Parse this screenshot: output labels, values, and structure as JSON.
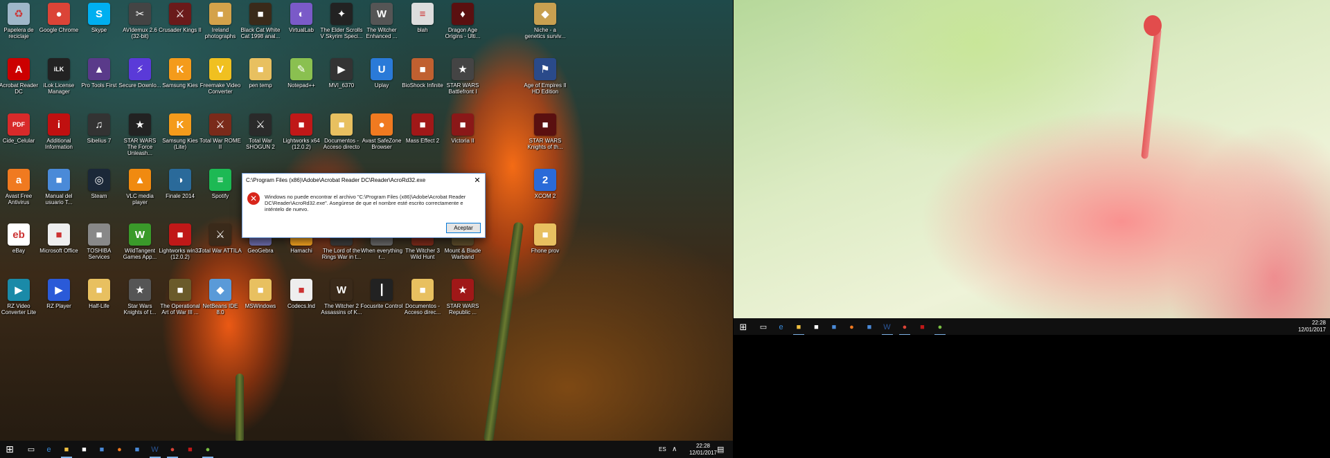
{
  "monitor1": {
    "icons": [
      {
        "label": "Papelera de reciclaje",
        "glyph": "♻",
        "color": "#9fb7c9"
      },
      {
        "label": "Google Chrome",
        "glyph": "●",
        "color": "#db4437"
      },
      {
        "label": "Skype",
        "glyph": "S",
        "color": "#00aff0"
      },
      {
        "label": "AVIdemux 2.6 (32-bit)",
        "glyph": "✂",
        "color": "#444"
      },
      {
        "label": "Crusader Kings II",
        "glyph": "⚔",
        "color": "#6a1a1a"
      },
      {
        "label": "Ireland photographs",
        "glyph": "■",
        "color": "#d4a24a"
      },
      {
        "label": "Black Cat White Cat 1998 anal...",
        "glyph": "■",
        "color": "#3a2a1a"
      },
      {
        "label": "VirtualLab",
        "glyph": "◐",
        "color": "#7a5ac8"
      },
      {
        "label": "The Elder Scrolls V Skyrim Speci...",
        "glyph": "✦",
        "color": "#222"
      },
      {
        "label": "The Witcher Enhanced ...",
        "glyph": "W",
        "color": "#555"
      },
      {
        "label": "blah",
        "glyph": "≡",
        "color": "#ddd"
      },
      {
        "label": "Dragon Age Origins - Ulti...",
        "glyph": "♦",
        "color": "#5a1010"
      },
      {
        "label": "Niche - a genetics surviv...",
        "glyph": "◆",
        "color": "#c8a050"
      },
      {
        "label": "Acrobat Reader DC",
        "glyph": "A",
        "color": "#c00"
      },
      {
        "label": "iLok License Manager",
        "glyph": "iLK",
        "color": "#222"
      },
      {
        "label": "Pro Tools First",
        "glyph": "▲",
        "color": "#5a3a8a"
      },
      {
        "label": "Secure Downlo...",
        "glyph": "⚡",
        "color": "#5a3ad8"
      },
      {
        "label": "Samsung Kies",
        "glyph": "K",
        "color": "#f49b1b"
      },
      {
        "label": "Freemake Video Converter",
        "glyph": "V",
        "color": "#f0c020"
      },
      {
        "label": "pen temp",
        "glyph": "■",
        "color": "#e8c060"
      },
      {
        "label": "Notepad++",
        "glyph": "✎",
        "color": "#8ac050"
      },
      {
        "label": "MVI_6370",
        "glyph": "▶",
        "color": "#333"
      },
      {
        "label": "Uplay",
        "glyph": "U",
        "color": "#2a7ad8"
      },
      {
        "label": "BioShock Infinite",
        "glyph": "■",
        "color": "#c06030"
      },
      {
        "label": "STAR WARS Battlefront I",
        "glyph": "★",
        "color": "#444"
      },
      {
        "label": "Age of Empires II HD Edition",
        "glyph": "⚑",
        "color": "#2a4a8a"
      },
      {
        "label": "Cide_Celular",
        "glyph": "PDF",
        "color": "#d82a2a"
      },
      {
        "label": "Additional Information",
        "glyph": "i",
        "color": "#c01010"
      },
      {
        "label": "Sibelius 7",
        "glyph": "♫",
        "color": "#333"
      },
      {
        "label": "STAR WARS The Force Unleash...",
        "glyph": "★",
        "color": "#222"
      },
      {
        "label": "Samsung Kies (Lite)",
        "glyph": "K",
        "color": "#f49b1b"
      },
      {
        "label": "Total War ROME II",
        "glyph": "⚔",
        "color": "#7a2a1a"
      },
      {
        "label": "Total War SHOGUN 2",
        "glyph": "⚔",
        "color": "#2a2a2a"
      },
      {
        "label": "Lightworks x64 (12.0.2)",
        "glyph": "■",
        "color": "#c01818"
      },
      {
        "label": "Documentos - Acceso directo",
        "glyph": "■",
        "color": "#e8c060"
      },
      {
        "label": "Avast SafeZone Browser",
        "glyph": "●",
        "color": "#f07a20"
      },
      {
        "label": "Mass Effect 2",
        "glyph": "■",
        "color": "#a01818"
      },
      {
        "label": "Victoria II",
        "glyph": "■",
        "color": "#8a1818"
      },
      {
        "label": "STAR WARS Knights of th...",
        "glyph": "■",
        "color": "#5a1010"
      },
      {
        "label": "Avast Free Antivirus",
        "glyph": "a",
        "color": "#f07a20"
      },
      {
        "label": "Manual del usuario T...",
        "glyph": "■",
        "color": "#4a8ad8"
      },
      {
        "label": "Steam",
        "glyph": "◎",
        "color": "#1b2838"
      },
      {
        "label": "VLC media player",
        "glyph": "▲",
        "color": "#f08a10"
      },
      {
        "label": "Finale 2014",
        "glyph": "◑",
        "color": "#2a6a9a"
      },
      {
        "label": "Spotify",
        "glyph": "≡",
        "color": "#1db954"
      },
      {
        "label": "XCOM 2",
        "glyph": "2",
        "color": "#2a6ad8"
      },
      {
        "label": "eBay",
        "glyph": "eb",
        "color": "#fff"
      },
      {
        "label": "Microsoft Office",
        "glyph": "■",
        "color": "#eee"
      },
      {
        "label": "TOSHIBA Services",
        "glyph": "■",
        "color": "#888"
      },
      {
        "label": "WildTangent Games App...",
        "glyph": "W",
        "color": "#3a9a2a"
      },
      {
        "label": "Lightworks win32 (12.0.2)",
        "glyph": "■",
        "color": "#c01818"
      },
      {
        "label": "Total War ATTILA",
        "glyph": "⚔",
        "color": "#3a2a1a"
      },
      {
        "label": "GeoGebra",
        "glyph": "○",
        "color": "#6a6aa8"
      },
      {
        "label": "Hamachi",
        "glyph": "●",
        "color": "#f0a020"
      },
      {
        "label": "The Lord of the Rings War in t...",
        "glyph": "■",
        "color": "#3a3a3a"
      },
      {
        "label": "When everything r...",
        "glyph": "■",
        "color": "#666"
      },
      {
        "label": "The Witcher 3 Wild Hunt",
        "glyph": "W",
        "color": "#7a2a1a"
      },
      {
        "label": "Mount & Blade Warband",
        "glyph": "⚔",
        "color": "#5a4a2a"
      },
      {
        "label": "Fhone prov",
        "glyph": "■",
        "color": "#e8c060"
      },
      {
        "label": "RZ Video Converter Lite",
        "glyph": "▶",
        "color": "#1a8aa8"
      },
      {
        "label": "RZ Player",
        "glyph": "▶",
        "color": "#2a5ad8"
      },
      {
        "label": "Half-Life",
        "glyph": "■",
        "color": "#e8c060"
      },
      {
        "label": "Star Wars Knights of t...",
        "glyph": "★",
        "color": "#555"
      },
      {
        "label": "The Operational Art of War III ...",
        "glyph": "■",
        "color": "#6a5a2a"
      },
      {
        "label": "NetBeans IDE 8.0",
        "glyph": "◆",
        "color": "#5a9ad8"
      },
      {
        "label": "MSWindows",
        "glyph": "■",
        "color": "#e8c060"
      },
      {
        "label": "Codecs.lnd",
        "glyph": "■",
        "color": "#eee"
      },
      {
        "label": "The Witcher 2 Assassins of K...",
        "glyph": "W",
        "color": "#3a2a1a"
      },
      {
        "label": "Focusrite Control",
        "glyph": "┃",
        "color": "#222"
      },
      {
        "label": "Documentos - Acceso direc...",
        "glyph": "■",
        "color": "#e8c060"
      },
      {
        "label": "STAR WARS Republic ...",
        "glyph": "★",
        "color": "#a01818"
      }
    ],
    "dialog": {
      "title": "C:\\Program Files (x86)\\Adobe\\Acrobat Reader DC\\Reader\\AcroRd32.exe",
      "close_glyph": "✕",
      "error_glyph": "✕",
      "message": "Windows no puede encontrar el archivo \"C:\\Program Files (x86)\\Adobe\\Acrobat Reader DC\\Reader\\AcroRd32.exe\". Asegúrese de que el nombre esté escrito correctamente e inténtelo de nuevo.",
      "ok_label": "Aceptar"
    },
    "taskbar": {
      "start_glyph": "⊞",
      "apps": [
        {
          "name": "task-view",
          "glyph": "▭",
          "color": "#fff"
        },
        {
          "name": "edge",
          "glyph": "e",
          "color": "#3a8ad8"
        },
        {
          "name": "file-explorer",
          "glyph": "■",
          "color": "#f0c040"
        },
        {
          "name": "store",
          "glyph": "■",
          "color": "#fff"
        },
        {
          "name": "photos",
          "glyph": "■",
          "color": "#4a8ad8"
        },
        {
          "name": "avast",
          "glyph": "●",
          "color": "#f07a20"
        },
        {
          "name": "paint",
          "glyph": "■",
          "color": "#4a8ad8"
        },
        {
          "name": "word",
          "glyph": "W",
          "color": "#2b579a"
        },
        {
          "name": "chrome",
          "glyph": "●",
          "color": "#db4437"
        },
        {
          "name": "lightworks",
          "glyph": "■",
          "color": "#c01818"
        },
        {
          "name": "utorrent",
          "glyph": "●",
          "color": "#7ac043"
        }
      ],
      "lang": "ES",
      "tray_up_glyph": "∧",
      "time": "22:28",
      "date": "12/01/2017",
      "notification_glyph": "▤"
    }
  },
  "monitor2": {
    "taskbar": {
      "start_glyph": "⊞",
      "apps": [
        {
          "name": "task-view",
          "glyph": "▭",
          "color": "#fff"
        },
        {
          "name": "edge",
          "glyph": "e",
          "color": "#3a8ad8"
        },
        {
          "name": "file-explorer",
          "glyph": "■",
          "color": "#f0c040"
        },
        {
          "name": "store",
          "glyph": "■",
          "color": "#fff"
        },
        {
          "name": "photos",
          "glyph": "■",
          "color": "#4a8ad8"
        },
        {
          "name": "avast",
          "glyph": "●",
          "color": "#f07a20"
        },
        {
          "name": "paint",
          "glyph": "■",
          "color": "#4a8ad8"
        },
        {
          "name": "word",
          "glyph": "W",
          "color": "#2b579a"
        },
        {
          "name": "chrome",
          "glyph": "●",
          "color": "#db4437"
        },
        {
          "name": "lightworks",
          "glyph": "■",
          "color": "#c01818"
        },
        {
          "name": "utorrent",
          "glyph": "●",
          "color": "#7ac043"
        }
      ],
      "time": "22:28",
      "date": "12/01/2017"
    }
  }
}
